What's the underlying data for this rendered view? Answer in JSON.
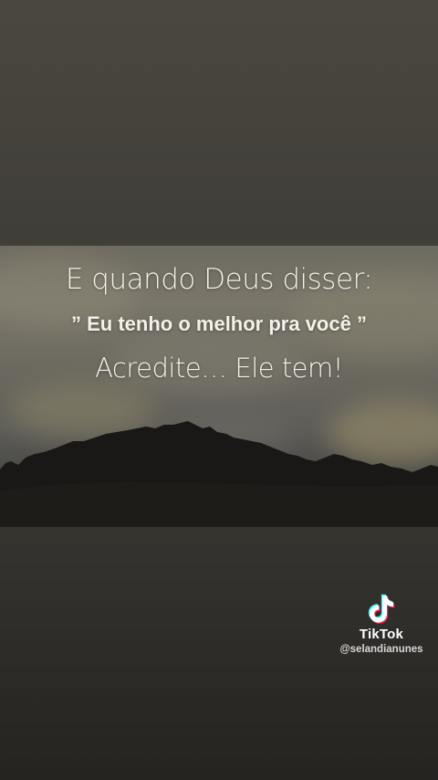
{
  "video": {
    "line1": "E quando Deus disser:",
    "line2": "” Eu tenho o melhor pra você ”",
    "line3": "Acredite… Ele tem!"
  },
  "watermark": {
    "brand": "TikTok",
    "handle": "@selandianunes",
    "icon": "tiktok-logo-icon"
  },
  "colors": {
    "background": "#403e38",
    "text": "#f3f1ea",
    "tiktok_cyan": "#25f4ee",
    "tiktok_red": "#fe2c55"
  }
}
